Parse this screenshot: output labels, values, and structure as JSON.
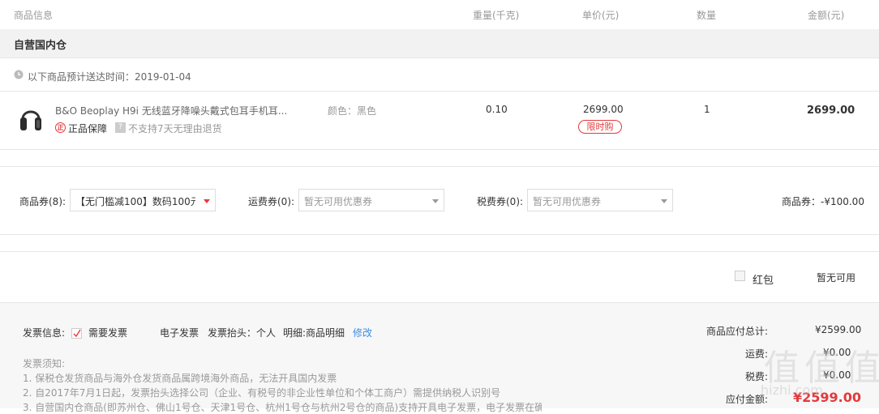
{
  "header": {
    "col_product": "商品信息",
    "col_weight": "重量(千克)",
    "col_price": "单价(元)",
    "col_qty": "数量",
    "col_amount": "金额(元)"
  },
  "store": {
    "name": "自营国内仓"
  },
  "delivery": {
    "text": "以下商品预计送达时间：2019-01-04"
  },
  "product": {
    "image_icon": "headphones-icon",
    "name": "B&O Beoplay H9i 无线蓝牙降噪头戴式包耳手机耳...",
    "badge_genuine": "正品保障",
    "badge_genuine_mark": "正",
    "badge_noreturn": "不支持7天无理由退货",
    "badge_noreturn_mark": "?",
    "color": "颜色：黑色",
    "weight": "0.10",
    "price": "2699.00",
    "promo_tag": "限时购",
    "qty": "1",
    "amount": "2699.00"
  },
  "coupons": {
    "goods_label": "商品券(8):",
    "goods_value": "【无门槛减100】数码100元...",
    "shipping_label": "运费券(0):",
    "shipping_value": "暂无可用优惠券",
    "tax_label": "税费券(0):",
    "tax_value": "暂无可用优惠券",
    "discount_text": "商品券：-¥100.00"
  },
  "redpack": {
    "label": "红包",
    "status": "暂无可用"
  },
  "invoice": {
    "info_label": "发票信息:",
    "need_label": "需要发票",
    "type": "电子发票",
    "title_label": "发票抬头：个人",
    "detail_label": "明细:商品明细",
    "edit": "修改",
    "notice_title": "发票须知:",
    "notice_1": "1. 保税仓发货商品与海外仓发货商品属跨境海外商品，无法开具国内发票",
    "notice_2": "2. 自2017年7月1日起，发票抬头选择公司（企业、有税号的非企业性单位和个体工商户）需提供纳税人识别号",
    "notice_3": "3. 自营国内仓商品(即苏州仓、佛山1号仓、天津1号仓、杭州1号仓与杭州2号仓的商品)支持开具电子发票，电子发票在确"
  },
  "summary": {
    "goods_total_label": "商品应付总计:",
    "goods_total": "¥2599.00",
    "shipping_label": "运费:",
    "shipping": "¥0.00",
    "tax_label": "税费:",
    "tax": "¥0.00",
    "pay_label": "应付金额:",
    "pay": "¥2599.00"
  },
  "watermark": {
    "text": "值 值 值",
    "sub": "hizhi.com"
  },
  "colors": {
    "accent_red": "#e4393c",
    "link_blue": "#3a8ee6",
    "band_gray": "#f2f2f2"
  }
}
